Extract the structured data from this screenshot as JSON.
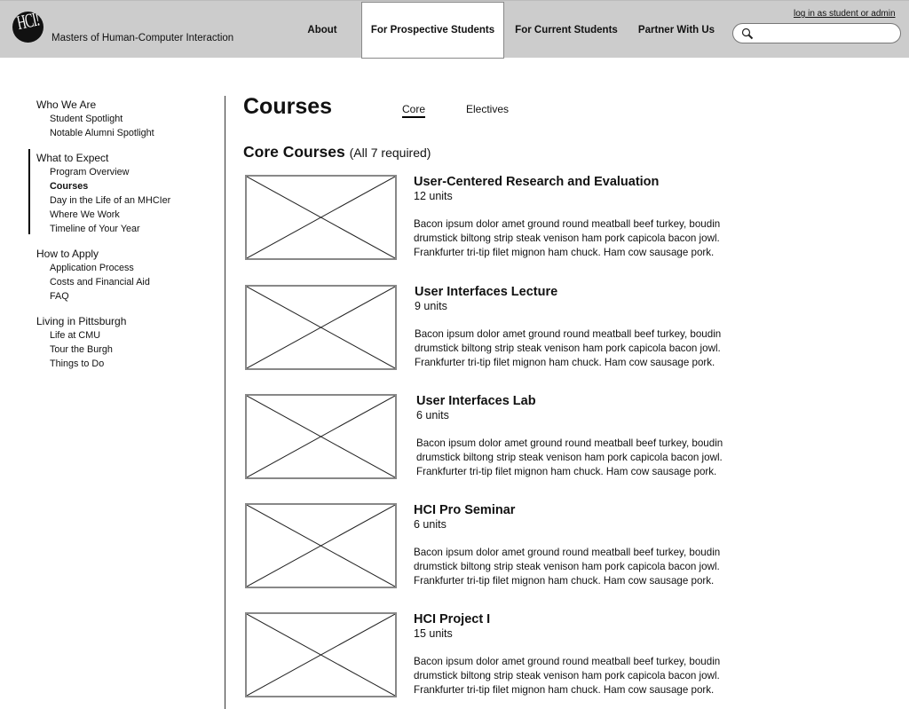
{
  "header": {
    "logo_text": "HCI!",
    "site_title": "Masters of Human-Computer Interaction",
    "nav": [
      {
        "label": "About",
        "active": false
      },
      {
        "label": "For Prospective Students",
        "active": true
      },
      {
        "label": "For Current Students",
        "active": false
      },
      {
        "label": "Partner With Us",
        "active": false
      }
    ],
    "login_link": "log in as student or admin",
    "search": {
      "placeholder": "",
      "value": ""
    }
  },
  "sidebar": {
    "groups": [
      {
        "title": "Who We Are",
        "items": [
          "Student Spotlight",
          "Notable Alumni Spotlight"
        ]
      },
      {
        "title": "What to Expect",
        "active": true,
        "items": [
          "Program Overview",
          "Courses",
          "Day in the Life of an MHCIer",
          "Where We Work",
          "Timeline of Your Year"
        ],
        "current_item": "Courses"
      },
      {
        "title": "How to Apply",
        "items": [
          "Application Process",
          "Costs and Financial Aid",
          "FAQ"
        ]
      },
      {
        "title": "Living in Pittsburgh",
        "items": [
          "Life at CMU",
          "Tour the Burgh",
          "Things to Do"
        ]
      }
    ]
  },
  "main": {
    "page_title": "Courses",
    "tabs": [
      {
        "label": "Core",
        "active": true
      },
      {
        "label": "Electives",
        "active": false
      }
    ],
    "section_heading": "Core Courses",
    "section_note": "(All 7 required)",
    "courses": [
      {
        "name": "User-Centered Research and Evaluation",
        "units": "12 units",
        "description": "Bacon ipsum dolor amet ground round meatball beef turkey, boudin drumstick biltong strip steak venison ham pork capicola bacon jowl. Frankfurter tri-tip filet mignon ham chuck. Ham cow sausage pork."
      },
      {
        "name": "User Interfaces Lecture",
        "units": "9 units",
        "description": "Bacon ipsum dolor amet ground round meatball beef turkey, boudin drumstick biltong strip steak venison ham pork capicola bacon jowl. Frankfurter tri-tip filet mignon ham chuck. Ham cow sausage pork."
      },
      {
        "name": "User Interfaces Lab",
        "units": "6 units",
        "description": "Bacon ipsum dolor amet ground round meatball beef turkey, boudin drumstick biltong strip steak venison ham pork capicola bacon jowl. Frankfurter tri-tip filet mignon ham chuck. Ham cow sausage pork."
      },
      {
        "name": "HCI Pro Seminar",
        "units": "6 units",
        "description": "Bacon ipsum dolor amet ground round meatball beef turkey, boudin drumstick biltong strip steak venison ham pork capicola bacon jowl. Frankfurter tri-tip filet mignon ham chuck. Ham cow sausage pork."
      },
      {
        "name": "HCI Project I",
        "units": "15 units",
        "description": "Bacon ipsum dolor amet ground round meatball beef turkey, boudin drumstick biltong strip steak venison ham pork capicola bacon jowl. Frankfurter tri-tip filet mignon ham chuck. Ham cow sausage pork."
      }
    ]
  },
  "colors": {
    "header_bg": "#cccccc",
    "active_nav_bg": "#ffffff",
    "text": "#111111",
    "placeholder_border": "#888888"
  },
  "icons": {
    "search": "search-icon",
    "logo": "hci-logo-icon",
    "image_placeholder": "image-placeholder-icon"
  }
}
